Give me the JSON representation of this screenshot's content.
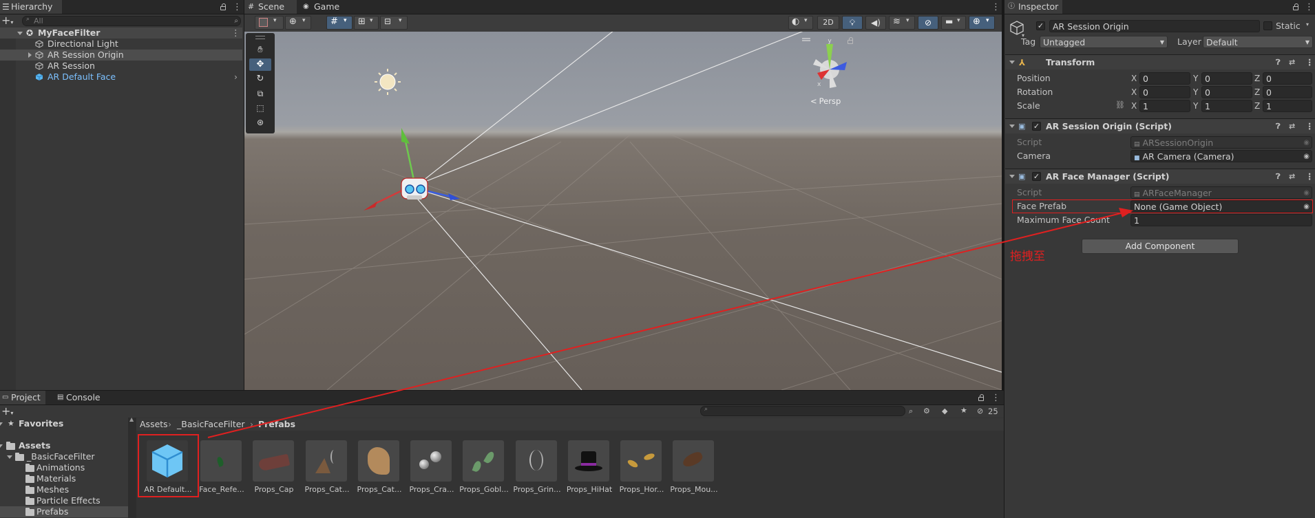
{
  "hierarchy": {
    "tab_label": "Hierarchy",
    "search_placeholder": "All",
    "scene_name": "MyFaceFilter",
    "items": [
      "Directional Light",
      "AR Session Origin",
      "AR Session",
      "AR Default Face"
    ]
  },
  "scene": {
    "tabs": [
      "Scene",
      "Game"
    ],
    "toggle_2d": "2D",
    "persp_label": "Persp",
    "gizmo_axes": [
      "y",
      "x"
    ]
  },
  "inspector": {
    "tab_label": "Inspector",
    "object_name": "AR Session Origin",
    "static_label": "Static",
    "tag_label": "Tag",
    "tag_value": "Untagged",
    "layer_label": "Layer",
    "layer_value": "Default",
    "transform": {
      "title": "Transform",
      "rows": [
        {
          "label": "Position",
          "x": "0",
          "y": "0",
          "z": "0"
        },
        {
          "label": "Rotation",
          "x": "0",
          "y": "0",
          "z": "0"
        },
        {
          "label": "Scale",
          "x": "1",
          "y": "1",
          "z": "1"
        }
      ],
      "axis_labels": [
        "X",
        "Y",
        "Z"
      ]
    },
    "ar_session_origin": {
      "title": "AR Session Origin (Script)",
      "script_label": "Script",
      "script_value": "ARSessionOrigin",
      "camera_label": "Camera",
      "camera_value": "AR Camera (Camera)"
    },
    "ar_face_manager": {
      "title": "AR Face Manager (Script)",
      "script_label": "Script",
      "script_value": "ARFaceManager",
      "face_prefab_label": "Face Prefab",
      "face_prefab_value": "None (Game Object)",
      "max_face_label": "Maximum Face Count",
      "max_face_value": "1"
    },
    "add_component": "Add Component",
    "annotation": "拖拽至"
  },
  "project": {
    "tabs": [
      "Project",
      "Console"
    ],
    "hidden_count": "25",
    "tree": {
      "favorites": "Favorites",
      "assets": "Assets",
      "basic": "_BasicFaceFilter",
      "folders": [
        "Animations",
        "Materials",
        "Meshes",
        "Particle Effects",
        "Prefabs"
      ]
    },
    "breadcrumb": [
      "Assets",
      "_BasicFaceFilter",
      "Prefabs"
    ],
    "assets": [
      "AR Default...",
      "Face_Refe...",
      "Props_Cap",
      "Props_Cat...",
      "Props_Cat...",
      "Props_Cra...",
      "Props_Gobl...",
      "Props_Grin...",
      "Props_HiHat",
      "Props_Hor...",
      "Props_Mou..."
    ]
  },
  "colors": {
    "selection_blue": "#7cc1ff",
    "highlight_red": "#e02020",
    "panel_bg": "#383838"
  }
}
